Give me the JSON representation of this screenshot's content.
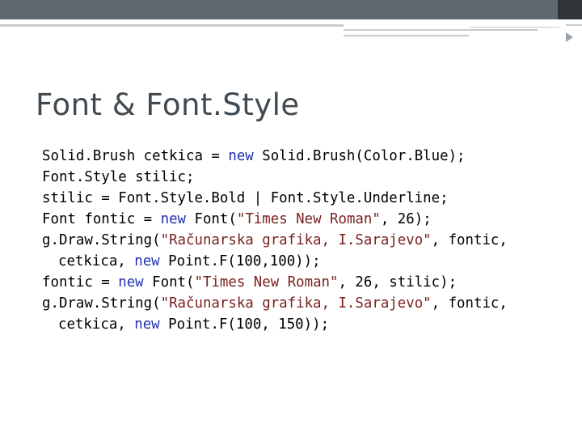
{
  "title": "Font & Font.Style",
  "code_lines": [
    [
      {
        "t": "Solid.Brush cetkica = ",
        "c": "plain"
      },
      {
        "t": "new",
        "c": "kw"
      },
      {
        "t": " Solid.Brush(Color.Blue);",
        "c": "plain"
      }
    ],
    [
      {
        "t": "Font.Style stilic;",
        "c": "plain"
      }
    ],
    [
      {
        "t": "stilic = Font.Style.Bold | Font.Style.Underline;",
        "c": "plain"
      }
    ],
    [
      {
        "t": "Font fontic = ",
        "c": "plain"
      },
      {
        "t": "new",
        "c": "kw"
      },
      {
        "t": " Font(",
        "c": "plain"
      },
      {
        "t": "\"Times New Roman\"",
        "c": "str"
      },
      {
        "t": ", 26);",
        "c": "plain"
      }
    ],
    [
      {
        "t": "g.Draw.String(",
        "c": "plain"
      },
      {
        "t": "\"Računarska grafika, I.Sarajevo\"",
        "c": "str"
      },
      {
        "t": ", fontic,",
        "c": "plain"
      }
    ],
    [
      {
        "t": "cetkica, ",
        "c": "plain"
      },
      {
        "t": "new",
        "c": "kw"
      },
      {
        "t": " Point.F(100,100));",
        "c": "plain"
      }
    ],
    [
      {
        "t": "fontic = ",
        "c": "plain"
      },
      {
        "t": "new",
        "c": "kw"
      },
      {
        "t": " Font(",
        "c": "plain"
      },
      {
        "t": "\"Times New Roman\"",
        "c": "str"
      },
      {
        "t": ", 26, stilic);",
        "c": "plain"
      }
    ],
    [
      {
        "t": "g.Draw.String(",
        "c": "plain"
      },
      {
        "t": "\"Računarska grafika, I.Sarajevo\"",
        "c": "str"
      },
      {
        "t": ", fontic,",
        "c": "plain"
      }
    ],
    [
      {
        "t": "cetkica, ",
        "c": "plain"
      },
      {
        "t": "new",
        "c": "kw"
      },
      {
        "t": " Point.F(100, 150));",
        "c": "plain"
      }
    ]
  ],
  "colors": {
    "keyword": "#1f2fb0",
    "string": "#7a2020",
    "title": "#404a50",
    "header_bar": "#5f6a70"
  }
}
